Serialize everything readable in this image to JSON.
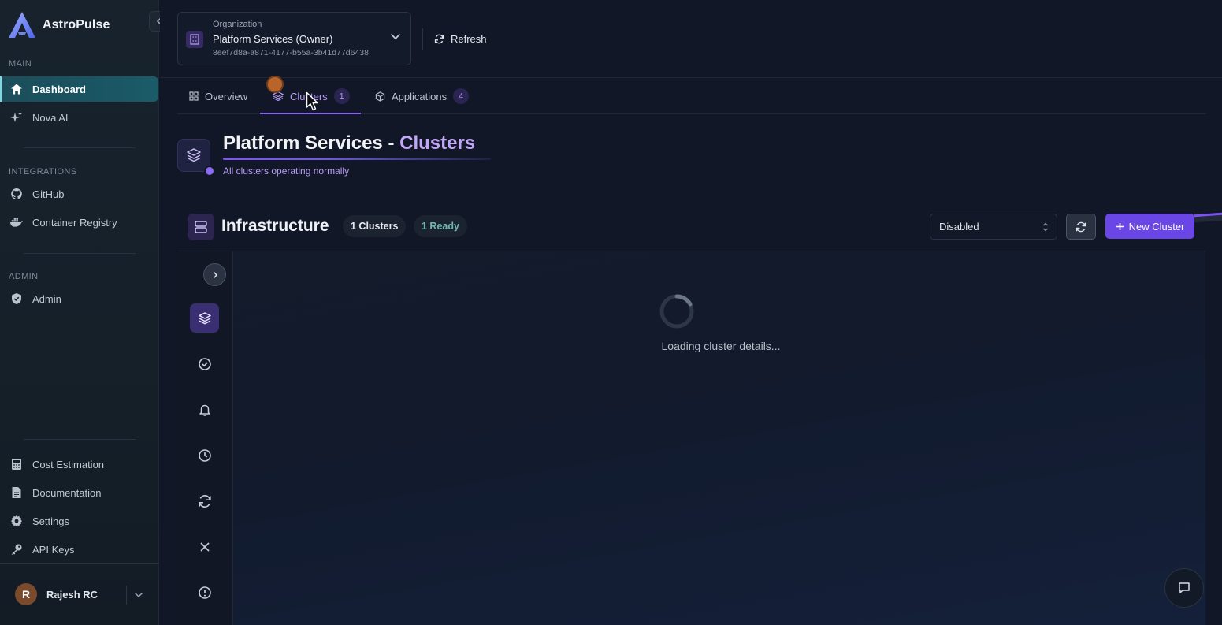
{
  "app": {
    "name": "AstroPulse"
  },
  "sidebar": {
    "sections": {
      "main": "MAIN",
      "integrations": "INTEGRATIONS",
      "admin": "ADMIN"
    },
    "main_items": [
      {
        "label": "Dashboard",
        "icon": "home-icon",
        "active": true
      },
      {
        "label": "Nova AI",
        "icon": "sparkle-icon",
        "active": false
      }
    ],
    "integration_items": [
      {
        "label": "GitHub",
        "icon": "github-icon"
      },
      {
        "label": "Container Registry",
        "icon": "docker-icon"
      }
    ],
    "admin_items": [
      {
        "label": "Admin",
        "icon": "shield-icon"
      }
    ],
    "bottom_items": [
      {
        "label": "Cost Estimation",
        "icon": "calculator-icon"
      },
      {
        "label": "Documentation",
        "icon": "document-icon"
      },
      {
        "label": "Settings",
        "icon": "gear-icon"
      },
      {
        "label": "API Keys",
        "icon": "key-icon"
      }
    ],
    "user": {
      "initial": "R",
      "name": "Rajesh RC"
    }
  },
  "header": {
    "org": {
      "label": "Organization",
      "name": "Platform Services (Owner)",
      "id": "8eef7d8a-a871-4177-b55a-3b41d77d6438"
    },
    "refresh_label": "Refresh"
  },
  "tabs": [
    {
      "label": "Overview",
      "icon": "grid-icon",
      "badge": "",
      "active": false
    },
    {
      "label": "Clusters",
      "icon": "layers-icon",
      "badge": "1",
      "active": true
    },
    {
      "label": "Applications",
      "icon": "cube-icon",
      "badge": "4",
      "active": false
    }
  ],
  "page": {
    "title_prefix": "Platform Services - ",
    "title_highlight": "Clusters",
    "subtitle": "All clusters operating normally"
  },
  "infrastructure": {
    "title": "Infrastructure",
    "clusters_pill": "1 Clusters",
    "ready_pill": "1 Ready",
    "select_value": "Disabled",
    "new_button": "New Cluster"
  },
  "panel": {
    "rail_icons": [
      "layers-icon",
      "check-circle-icon",
      "bell-icon",
      "clock-icon",
      "refresh-icon",
      "close-icon",
      "alert-circle-icon"
    ],
    "loading_text": "Loading cluster details..."
  },
  "colors": {
    "accent": "#6b46e6",
    "active_nav": "#1b5b68",
    "highlight_text": "#c3a7f7",
    "ready_text": "#6fb6b0"
  }
}
